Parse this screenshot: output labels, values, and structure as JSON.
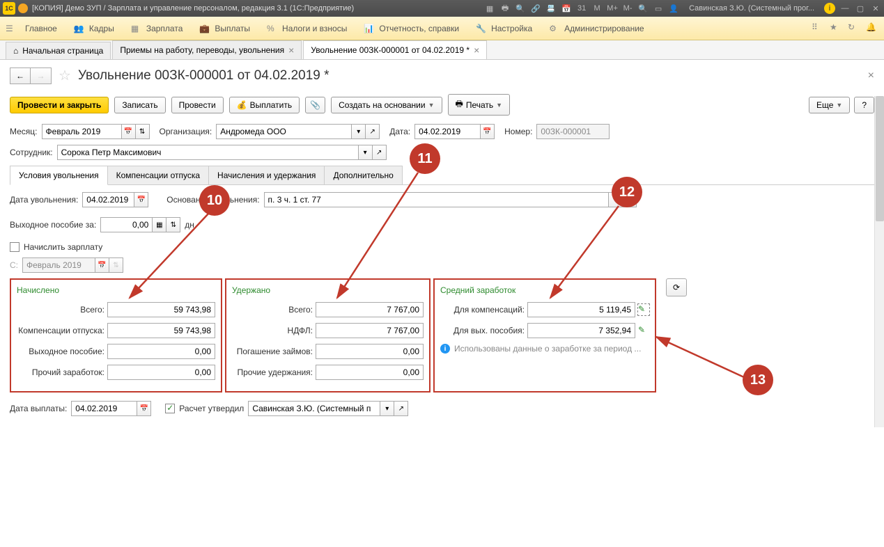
{
  "titlebar": {
    "title": "[КОПИЯ] Демо ЗУП / Зарплата и управление персоналом, редакция 3.1  (1С:Предприятие)",
    "user": "Савинская З.Ю. (Системный прог..."
  },
  "mainmenu": {
    "items": [
      "Главное",
      "Кадры",
      "Зарплата",
      "Выплаты",
      "Налоги и взносы",
      "Отчетность, справки",
      "Настройка",
      "Администрирование"
    ]
  },
  "tabs": {
    "home": "Начальная страница",
    "t1": "Приемы на работу, переводы, увольнения",
    "t2": "Увольнение 00ЗК-000001 от 04.02.2019 *"
  },
  "doc": {
    "title": "Увольнение 00ЗК-000001 от 04.02.2019 *"
  },
  "toolbar": {
    "post_close": "Провести и закрыть",
    "save": "Записать",
    "post": "Провести",
    "pay": "Выплатить",
    "create_based": "Создать на основании",
    "print": "Печать",
    "more": "Еще",
    "help": "?"
  },
  "form": {
    "month_lbl": "Месяц:",
    "month": "Февраль 2019",
    "org_lbl": "Организация:",
    "org": "Андромеда ООО",
    "date_lbl": "Дата:",
    "date": "04.02.2019",
    "num_lbl": "Номер:",
    "num": "00ЗК-000001",
    "emp_lbl": "Сотрудник:",
    "emp": "Сорока Петр Максимович"
  },
  "subtabs": {
    "t1": "Условия увольнения",
    "t2": "Компенсации отпуска",
    "t3": "Начисления и удержания",
    "t4": "Дополнительно"
  },
  "cond": {
    "dismiss_date_lbl": "Дата увольнения:",
    "dismiss_date": "04.02.2019",
    "reason_lbl": "Основание увольнения:",
    "reason": "п. 3 ч. 1 ст. 77",
    "sev_lbl": "Выходное пособие за:",
    "sev_val": "0,00",
    "sev_unit": "дн.",
    "calc_salary": "Начислить зарплату",
    "from_lbl": "С:",
    "from": "Февраль 2019"
  },
  "accrued": {
    "title": "Начислено",
    "total_lbl": "Всего:",
    "total": "59 743,98",
    "vac_lbl": "Компенсации отпуска:",
    "vac": "59 743,98",
    "sev_lbl": "Выходное пособие:",
    "sev": "0,00",
    "other_lbl": "Прочий заработок:",
    "other": "0,00"
  },
  "withheld": {
    "title": "Удержано",
    "total_lbl": "Всего:",
    "total": "7 767,00",
    "ndfl_lbl": "НДФЛ:",
    "ndfl": "7 767,00",
    "loan_lbl": "Погашение займов:",
    "loan": "0,00",
    "other_lbl": "Прочие удержания:",
    "other": "0,00"
  },
  "avg": {
    "title": "Средний заработок",
    "comp_lbl": "Для компенсаций:",
    "comp": "5 119,45",
    "sev_lbl": "Для вых. пособия:",
    "sev": "7 352,94",
    "info": "Использованы данные о заработке за период ..."
  },
  "pay": {
    "date_lbl": "Дата выплаты:",
    "date": "04.02.2019",
    "approved": "Расчет утвердил",
    "approver": "Савинская З.Ю. (Системный п"
  },
  "callouts": {
    "c10": "10",
    "c11": "11",
    "c12": "12",
    "c13": "13"
  }
}
